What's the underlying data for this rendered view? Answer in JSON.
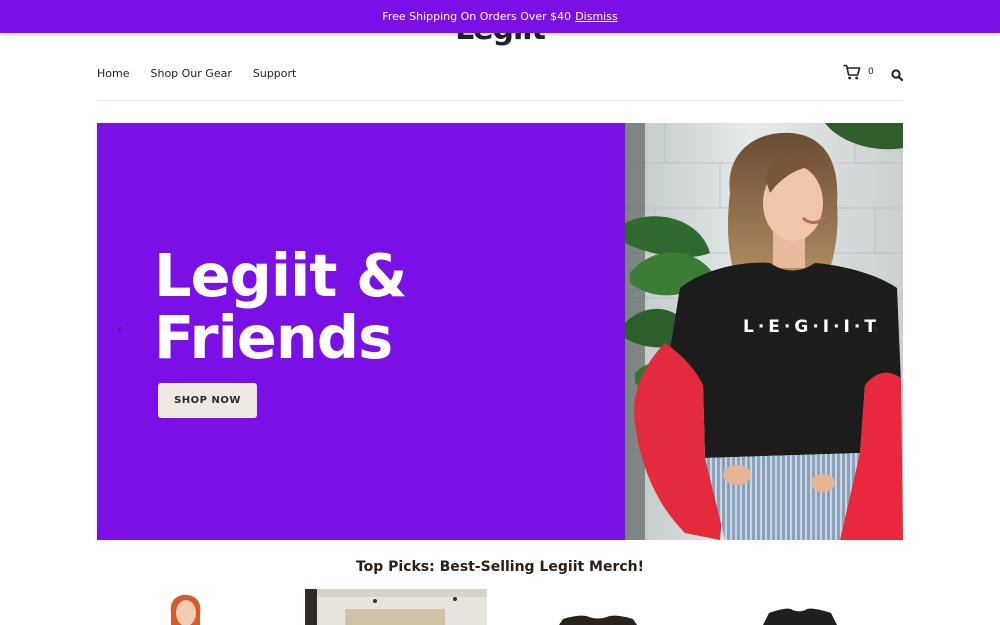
{
  "promo": {
    "text": "Free Shipping On Orders Over $40",
    "dismiss_label": "Dismiss"
  },
  "brand": {
    "logo": "Legiit",
    "accent": "#7b10e6"
  },
  "nav": {
    "items": [
      {
        "label": "Home"
      },
      {
        "label": "Shop Our Gear"
      },
      {
        "label": "Support"
      }
    ]
  },
  "cart": {
    "count": "0",
    "icon": "cart-icon"
  },
  "search": {
    "icon": "search-icon"
  },
  "hero": {
    "title_line1": "Legiit &",
    "title_line2": "Friends",
    "cta_label": "SHOP NOW",
    "shirt_text": "L·E·G·I·I·T",
    "prev_icon": "chevron-left-icon",
    "next_icon": "chevron-right-icon"
  },
  "top_picks": {
    "title": "Top Picks: Best-Selling Legiit Merch!"
  }
}
